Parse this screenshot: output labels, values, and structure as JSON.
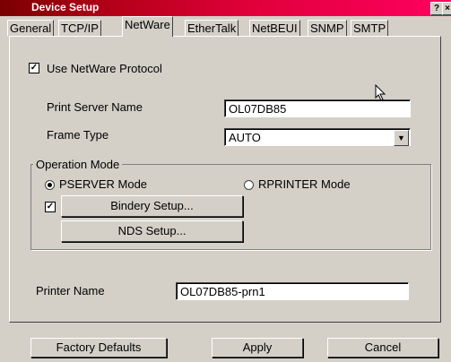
{
  "window": {
    "title": "Device Setup",
    "help_label": "?",
    "close_label": "×"
  },
  "tabs": [
    {
      "label": "General"
    },
    {
      "label": "TCP/IP"
    },
    {
      "label": "NetWare"
    },
    {
      "label": "EtherTalk"
    },
    {
      "label": "NetBEUI"
    },
    {
      "label": "SNMP"
    },
    {
      "label": "SMTP"
    }
  ],
  "netware": {
    "use_protocol_label": "Use NetWare Protocol",
    "use_protocol_checked": true,
    "print_server_label": "Print Server Name",
    "print_server_value": "OL07DB85",
    "frame_type_label": "Frame Type",
    "frame_type_value": "AUTO",
    "operation_mode": {
      "group_label": "Operation Mode",
      "pserver_label": "PSERVER Mode",
      "rprinter_label": "RPRINTER Mode",
      "selected": "PSERVER",
      "bindery_checked": true,
      "bindery_button": "Bindery Setup...",
      "nds_button": "NDS Setup..."
    },
    "printer_name_label": "Printer Name",
    "printer_name_value": "OL07DB85-prn1"
  },
  "footer": {
    "factory_label": "Factory Defaults",
    "apply_label": "Apply",
    "cancel_label": "Cancel"
  }
}
